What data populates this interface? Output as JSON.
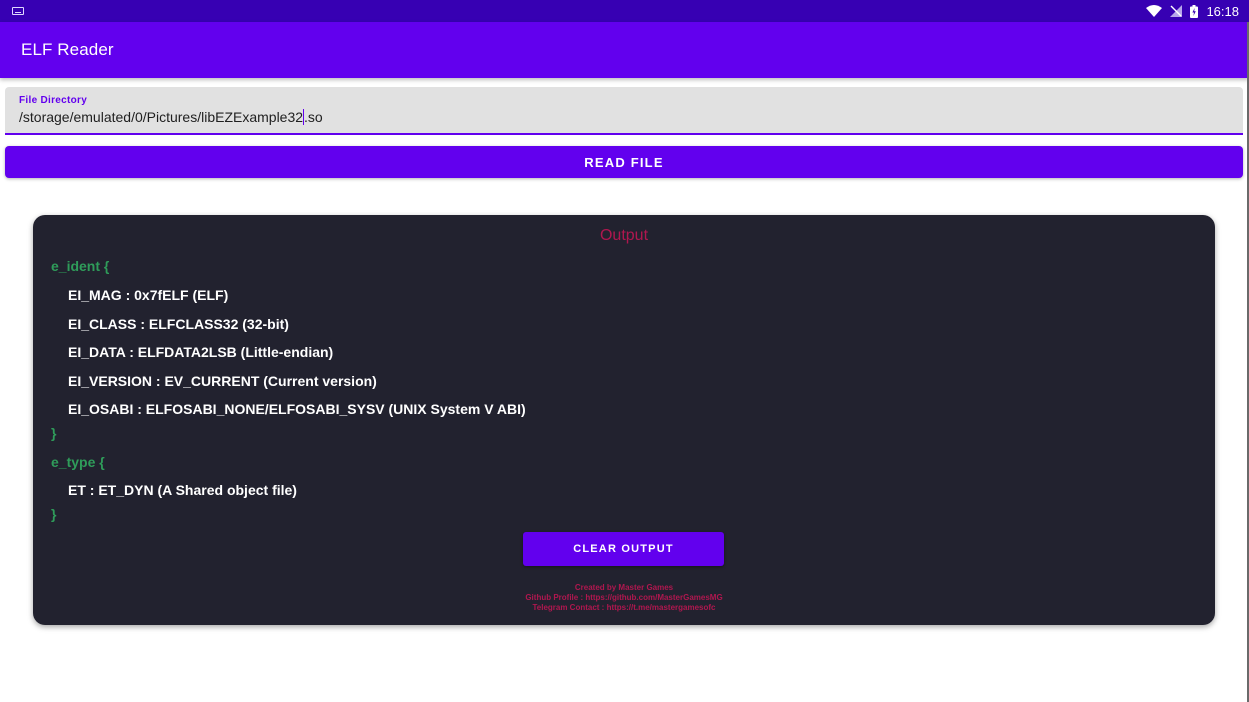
{
  "status_bar": {
    "time": "16:18",
    "icons": [
      "keyboard-icon",
      "wifi-icon",
      "signal-icon",
      "battery-icon"
    ]
  },
  "app_bar": {
    "title": "ELF Reader"
  },
  "file_field": {
    "label": "File Directory",
    "value_before_cursor": "/storage/emulated/0/Pictures/libEZExample32",
    "value_after_cursor": ".so"
  },
  "read_button": {
    "label": "READ FILE"
  },
  "output": {
    "title": "Output",
    "lines": [
      {
        "text": "e_ident {",
        "kind": "key"
      },
      {
        "text": "EI_MAG : 0x7fELF (ELF)",
        "kind": "field"
      },
      {
        "text": "EI_CLASS : ELFCLASS32 (32-bit)",
        "kind": "field"
      },
      {
        "text": "EI_DATA : ELFDATA2LSB (Little-endian)",
        "kind": "field"
      },
      {
        "text": "EI_VERSION : EV_CURRENT (Current version)",
        "kind": "field"
      },
      {
        "text": "EI_OSABI : ELFOSABI_NONE/ELFOSABI_SYSV (UNIX System V ABI)",
        "kind": "field"
      },
      {
        "text": "}",
        "kind": "key"
      },
      {
        "text": "e_type {",
        "kind": "key"
      },
      {
        "text": "ET : ET_DYN (A Shared object file)",
        "kind": "field"
      },
      {
        "text": "}",
        "kind": "key"
      }
    ],
    "clear_button_label": "CLEAR OUTPUT",
    "credits": [
      "Created by Master Games",
      "Github Profile : https://github.com/MasterGamesMG",
      "Telegram Contact : https://t.me/mastergamesofc"
    ]
  },
  "colors": {
    "primary": "#6200ee",
    "status_bar": "#3700b3",
    "card_background": "#22222f",
    "key_text": "#2f9c5a",
    "accent_text": "#b0174f"
  }
}
